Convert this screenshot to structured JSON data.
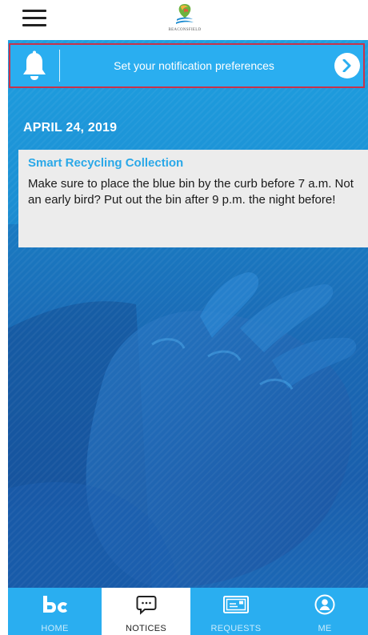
{
  "header": {
    "menu_icon": "hamburger-menu-icon",
    "logo_text": "BEACONSFIELD"
  },
  "notification_bar": {
    "icon": "bell-icon",
    "text": "Set your notification preferences",
    "arrow_icon": "chevron-right-icon"
  },
  "feed": {
    "date": "APRIL 24, 2019",
    "notices": [
      {
        "title": "Smart Recycling Collection",
        "body": "Make sure to place the blue bin by the curb before 7 a.m. Not an early bird? Put out the bin after 9 p.m. the night before!"
      }
    ]
  },
  "tabbar": {
    "active": "NOTICES",
    "tabs": [
      {
        "label": "HOME",
        "icon": "bc-logo-icon"
      },
      {
        "label": "NOTICES",
        "icon": "speech-bubble-icon"
      },
      {
        "label": "REQUESTS",
        "icon": "envelope-icon"
      },
      {
        "label": "ME",
        "icon": "user-icon"
      }
    ]
  },
  "colors": {
    "accent": "#2aaef0",
    "highlight_border": "#c8324a",
    "card_background": "#ececec",
    "card_title": "#2aa8e8"
  }
}
